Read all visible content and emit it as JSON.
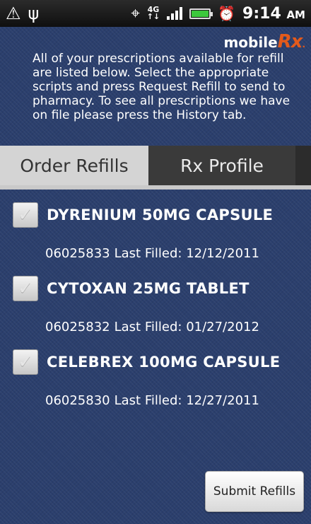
{
  "status_bar": {
    "time": "9:14",
    "ampm": "AM",
    "network": "4G",
    "icons": [
      "warning-icon",
      "usb-icon",
      "gps-icon",
      "network-4g-icon",
      "signal-icon",
      "battery-icon",
      "alarm-icon"
    ]
  },
  "brand": {
    "prefix": "mobile",
    "rx": "Rx",
    "mark": "."
  },
  "instructions": "All of your prescriptions available for refill are listed below. Select the appropriate scripts and press Request Refill to send to pharmacy. To see all prescriptions we have on file please press the History tab.",
  "tabs": [
    {
      "label": "Order Refills",
      "active": true
    },
    {
      "label": "Rx Profile",
      "active": false
    }
  ],
  "prescriptions": [
    {
      "name": "DYRENIUM 50MG CAPSULE",
      "rx_number": "06025833",
      "last_filled_label": "Last Filled:",
      "last_filled": "12/12/2011",
      "checked": true
    },
    {
      "name": "CYTOXAN 25MG TABLET",
      "rx_number": "06025832",
      "last_filled_label": "Last Filled:",
      "last_filled": "01/27/2012",
      "checked": true
    },
    {
      "name": "CELEBREX 100MG CAPSULE",
      "rx_number": "06025830",
      "last_filled_label": "Last Filled:",
      "last_filled": "12/27/2011",
      "checked": true
    }
  ],
  "submit_label": "Submit Refills",
  "colors": {
    "background": "#2b3f6d",
    "accent": "#e35a1b",
    "tab_active": "#d4d4d4",
    "tab_inactive": "#3a3a3a"
  }
}
